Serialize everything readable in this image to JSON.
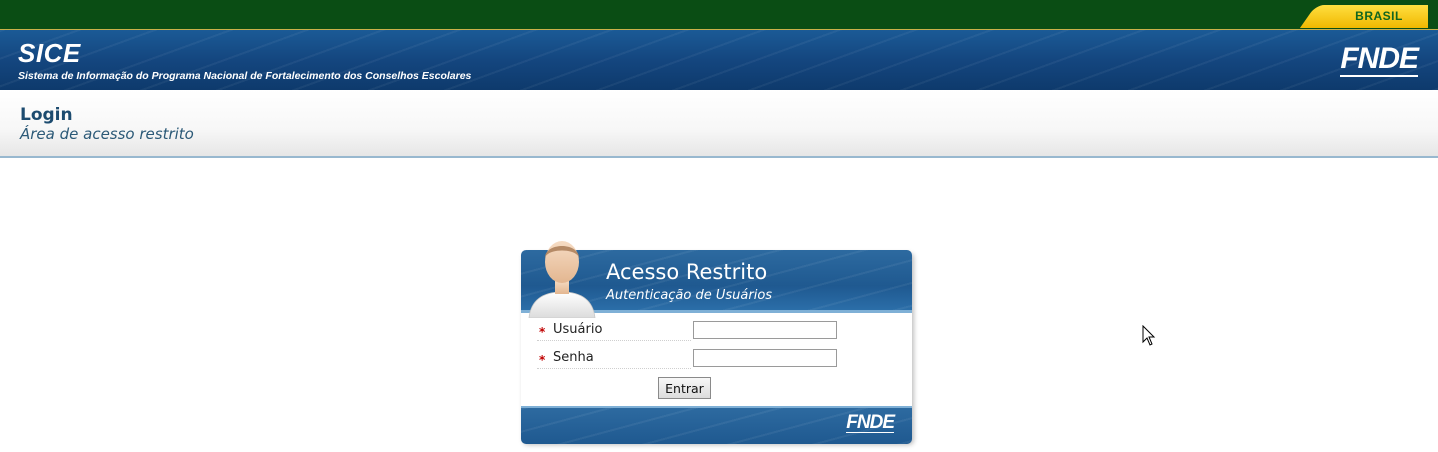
{
  "govbar": {
    "brand": "BRASIL"
  },
  "header": {
    "app_title": "SICE",
    "app_subtitle": "Sistema de Informação do Programa Nacional de Fortalecimento dos Conselhos Escolares",
    "logo": "FNDE"
  },
  "page": {
    "title": "Login",
    "subtitle": "Área de acesso restrito"
  },
  "login": {
    "title": "Acesso Restrito",
    "subtitle": "Autenticação de Usuários",
    "fields": [
      {
        "label": "Usuário",
        "required_mark": "*",
        "value": ""
      },
      {
        "label": "Senha",
        "required_mark": "*",
        "value": ""
      }
    ],
    "submit_label": "Entrar",
    "footer_logo": "FNDE"
  },
  "colors": {
    "gov_green": "#0a4d14",
    "header_blue": "#14467f",
    "brasil_yellow": "#f0b800",
    "title_text": "#1c4b6f",
    "required_red": "#c00000"
  },
  "icons": [
    "user-avatar-icon",
    "mouse-cursor-icon"
  ]
}
